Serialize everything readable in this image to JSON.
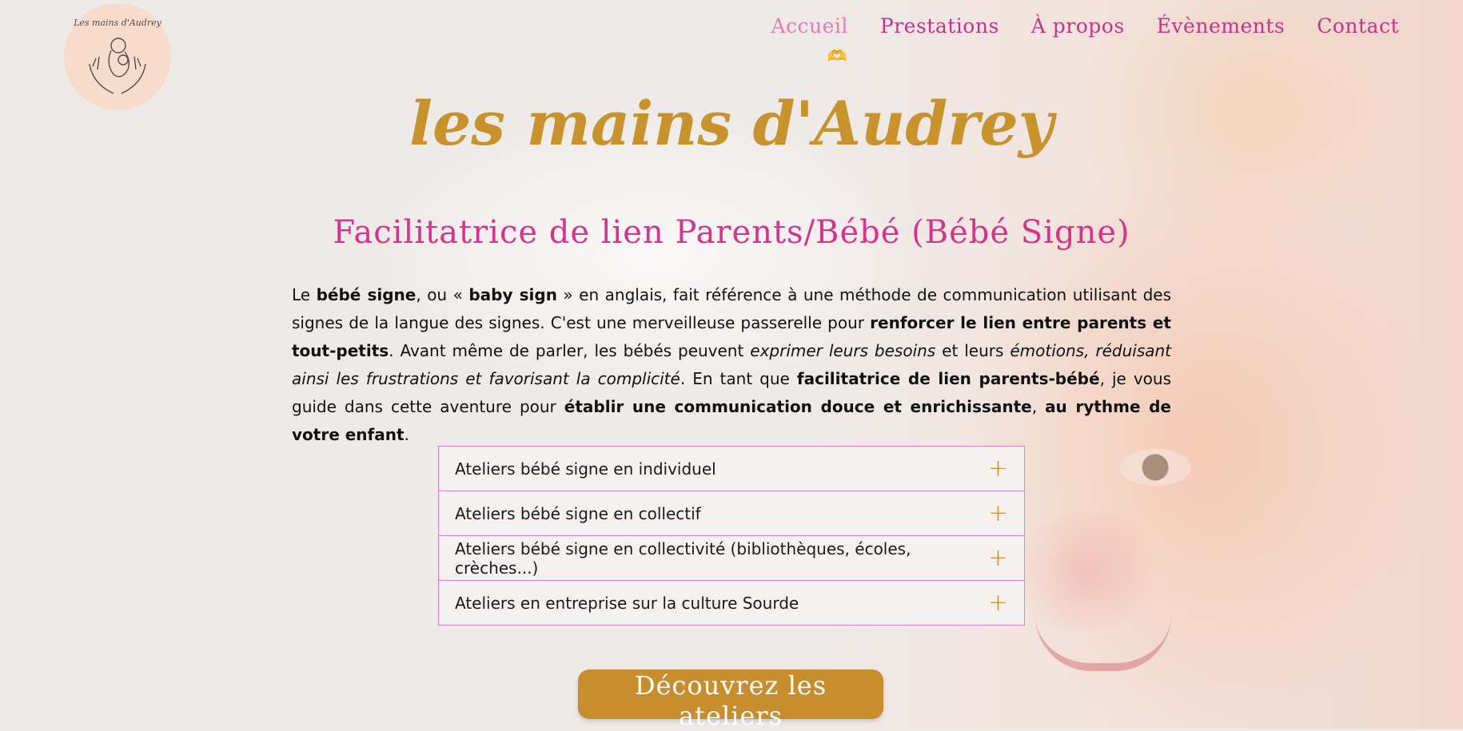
{
  "logo": {
    "text": "Les mains d'Audrey"
  },
  "nav": {
    "items": [
      {
        "label": "Accueil",
        "active": true
      },
      {
        "label": "Prestations",
        "active": false
      },
      {
        "label": "À propos",
        "active": false
      },
      {
        "label": "Évènements",
        "active": false
      },
      {
        "label": "Contact",
        "active": false
      }
    ],
    "active_indicator_icon": "hands-heart-icon"
  },
  "hero": {
    "brand": "les mains d'Audrey",
    "subtitle": "Facilitatrice de lien Parents/Bébé (Bébé Signe)"
  },
  "intro": {
    "segments": [
      {
        "text": "Le ",
        "style": "normal"
      },
      {
        "text": "bébé signe",
        "style": "bold"
      },
      {
        "text": ", ou « ",
        "style": "normal"
      },
      {
        "text": "baby sign",
        "style": "bold"
      },
      {
        "text": " » en anglais, fait référence à une méthode de communication utilisant des signes de la langue des signes. C'est une merveilleuse passerelle pour ",
        "style": "normal"
      },
      {
        "text": "renforcer le lien entre parents et tout-petits",
        "style": "bold"
      },
      {
        "text": ". Avant même de parler, les bébés peuvent ",
        "style": "normal"
      },
      {
        "text": "exprimer leurs besoins",
        "style": "italic"
      },
      {
        "text": " et leurs ",
        "style": "normal"
      },
      {
        "text": "émotions, réduisant ainsi les frustrations et favorisant la complicité",
        "style": "italic"
      },
      {
        "text": ". En tant que ",
        "style": "normal"
      },
      {
        "text": "facilitatrice de lien parents-bébé",
        "style": "bold"
      },
      {
        "text": ", je vous guide dans cette aventure pour ",
        "style": "normal"
      },
      {
        "text": "établir une communication douce et enrichissante",
        "style": "bold"
      },
      {
        "text": ", ",
        "style": "normal"
      },
      {
        "text": "au rythme de votre enfant",
        "style": "bold"
      },
      {
        "text": ".",
        "style": "normal"
      }
    ]
  },
  "accordion": {
    "items": [
      {
        "label": "Ateliers bébé signe en individuel",
        "icon": "plus-icon"
      },
      {
        "label": "Ateliers bébé signe en collectif",
        "icon": "plus-icon"
      },
      {
        "label": "Ateliers bébé signe en collectivité (bibliothèques, écoles, crèches...)",
        "icon": "plus-icon"
      },
      {
        "label": "Ateliers en entreprise sur la culture Sourde",
        "icon": "plus-icon"
      }
    ]
  },
  "cta": {
    "label": "Découvrez les ateliers"
  },
  "colors": {
    "accent_gold": "#c88d2c",
    "accent_pink": "#d6338c",
    "nav_active": "#e67cb0",
    "border_pink": "#e27fbf"
  }
}
